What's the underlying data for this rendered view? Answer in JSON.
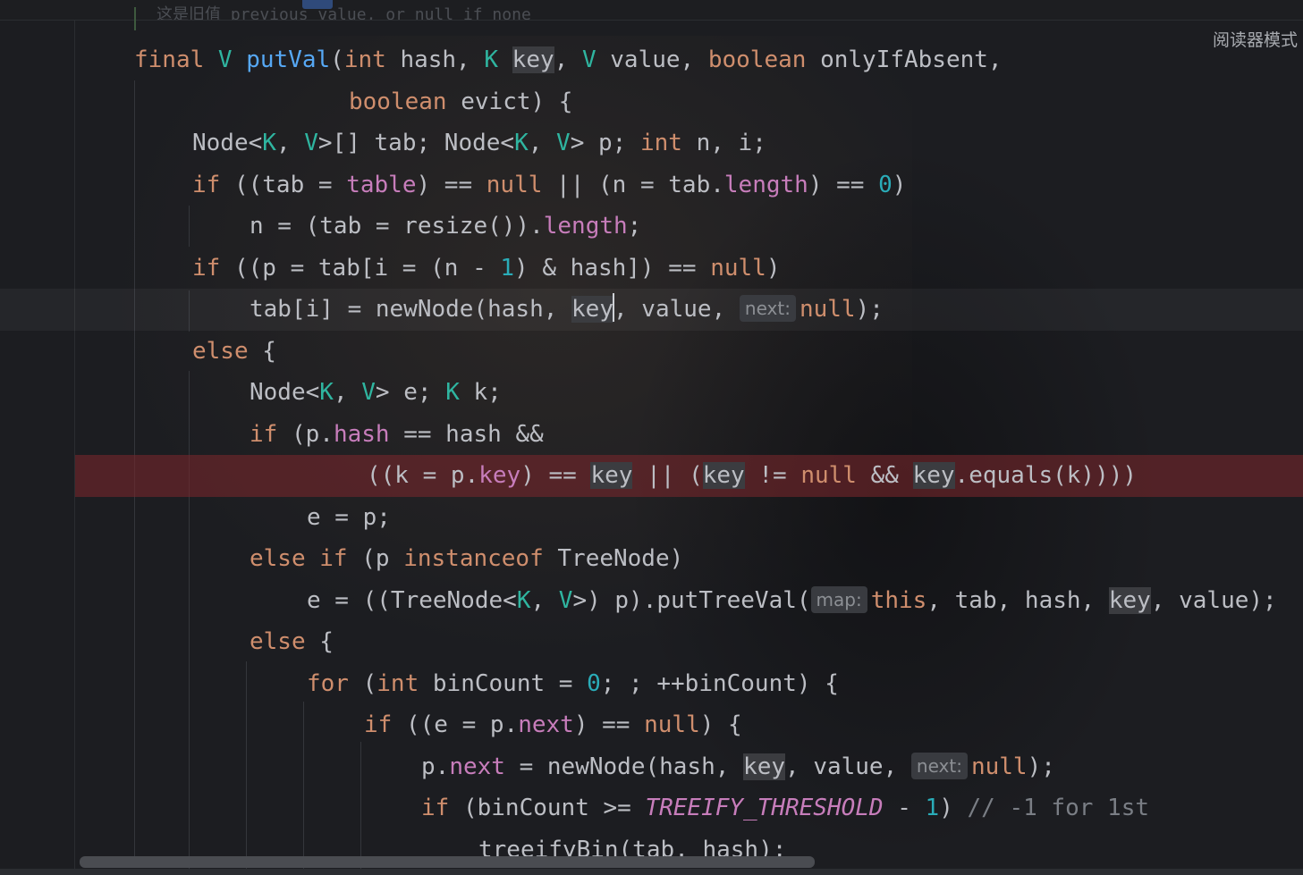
{
  "top_hint": "这是旧值 previous value, or null if none",
  "reader_mode_label": "阅读器模式",
  "code_lines": [
    {
      "indent": 150,
      "parts": [
        {
          "t": "final ",
          "c": "kw"
        },
        {
          "t": "V ",
          "c": "ty"
        },
        {
          "t": "putVal",
          "c": "fn"
        },
        {
          "t": "("
        },
        {
          "t": "int ",
          "c": "kw"
        },
        {
          "t": "hash, "
        },
        {
          "t": "K ",
          "c": "ty"
        },
        {
          "t": "key",
          "c": "hl"
        },
        {
          "t": ", "
        },
        {
          "t": "V ",
          "c": "ty"
        },
        {
          "t": "value, "
        },
        {
          "t": "boolean ",
          "c": "kw"
        },
        {
          "t": "onlyIfAbsent,"
        }
      ]
    },
    {
      "indent": 390,
      "parts": [
        {
          "t": "boolean ",
          "c": "kw"
        },
        {
          "t": "evict) {"
        }
      ]
    },
    {
      "indent": 215,
      "parts": [
        {
          "t": "Node<"
        },
        {
          "t": "K",
          "c": "ty"
        },
        {
          "t": ", "
        },
        {
          "t": "V",
          "c": "ty"
        },
        {
          "t": ">[] tab; Node<"
        },
        {
          "t": "K",
          "c": "ty"
        },
        {
          "t": ", "
        },
        {
          "t": "V",
          "c": "ty"
        },
        {
          "t": "> p; "
        },
        {
          "t": "int ",
          "c": "kw"
        },
        {
          "t": "n, i;"
        }
      ]
    },
    {
      "indent": 215,
      "parts": [
        {
          "t": "if ",
          "c": "kw"
        },
        {
          "t": "((tab = "
        },
        {
          "t": "table",
          "c": "fld"
        },
        {
          "t": ") == "
        },
        {
          "t": "null",
          "c": "kw"
        },
        {
          "t": " || (n = tab."
        },
        {
          "t": "length",
          "c": "fld"
        },
        {
          "t": ") == "
        },
        {
          "t": "0",
          "c": "num"
        },
        {
          "t": ")"
        }
      ]
    },
    {
      "indent": 279,
      "parts": [
        {
          "t": "n = (tab = resize())."
        },
        {
          "t": "length",
          "c": "fld"
        },
        {
          "t": ";"
        }
      ]
    },
    {
      "indent": 215,
      "parts": [
        {
          "t": "if ",
          "c": "kw"
        },
        {
          "t": "((p = tab[i = (n - "
        },
        {
          "t": "1",
          "c": "num"
        },
        {
          "t": ") & hash]) == "
        },
        {
          "t": "null",
          "c": "kw"
        },
        {
          "t": ")"
        }
      ]
    },
    {
      "indent": 279,
      "current": true,
      "parts": [
        {
          "t": "tab[i] = newNode(hash, "
        },
        {
          "t": "key",
          "c": "hl",
          "cursor": true
        },
        {
          "t": ", value, "
        },
        {
          "hint": "next:"
        },
        {
          "t": "null",
          "c": "kw"
        },
        {
          "t": ");"
        }
      ]
    },
    {
      "indent": 215,
      "parts": [
        {
          "t": "else ",
          "c": "kw"
        },
        {
          "t": "{"
        }
      ]
    },
    {
      "indent": 279,
      "parts": [
        {
          "t": "Node<"
        },
        {
          "t": "K",
          "c": "ty"
        },
        {
          "t": ", "
        },
        {
          "t": "V",
          "c": "ty"
        },
        {
          "t": "> e; "
        },
        {
          "t": "K ",
          "c": "ty"
        },
        {
          "t": "k;"
        }
      ]
    },
    {
      "indent": 279,
      "parts": [
        {
          "t": "if ",
          "c": "kw"
        },
        {
          "t": "(p."
        },
        {
          "t": "hash",
          "c": "fld"
        },
        {
          "t": " == hash &&"
        }
      ]
    },
    {
      "indent": 410,
      "breakpoint": true,
      "parts": [
        {
          "t": "((k = p."
        },
        {
          "t": "key",
          "c": "fld"
        },
        {
          "t": ") == "
        },
        {
          "t": "key",
          "c": "hl"
        },
        {
          "t": " || ("
        },
        {
          "t": "key",
          "c": "hl"
        },
        {
          "t": " != "
        },
        {
          "t": "null",
          "c": "kw"
        },
        {
          "t": " && "
        },
        {
          "t": "key",
          "c": "hl"
        },
        {
          "t": ".equals(k)))"
        },
        {
          "t": ")"
        }
      ]
    },
    {
      "indent": 343,
      "parts": [
        {
          "t": "e = p;"
        }
      ]
    },
    {
      "indent": 279,
      "parts": [
        {
          "t": "else if ",
          "c": "kw"
        },
        {
          "t": "(p "
        },
        {
          "t": "instanceof ",
          "c": "kw"
        },
        {
          "t": "TreeNode)"
        }
      ]
    },
    {
      "indent": 343,
      "parts": [
        {
          "t": "e = ((TreeNode<"
        },
        {
          "t": "K",
          "c": "ty"
        },
        {
          "t": ", "
        },
        {
          "t": "V",
          "c": "ty"
        },
        {
          "t": ">) p).putTreeVal("
        },
        {
          "hint": "map:"
        },
        {
          "t": "this",
          "c": "kw"
        },
        {
          "t": ", tab, hash, "
        },
        {
          "t": "key",
          "c": "hl"
        },
        {
          "t": ", value);"
        }
      ]
    },
    {
      "indent": 279,
      "parts": [
        {
          "t": "else ",
          "c": "kw"
        },
        {
          "t": "{"
        }
      ]
    },
    {
      "indent": 343,
      "parts": [
        {
          "t": "for ",
          "c": "kw"
        },
        {
          "t": "("
        },
        {
          "t": "int ",
          "c": "kw"
        },
        {
          "t": "binCount = "
        },
        {
          "t": "0",
          "c": "num"
        },
        {
          "t": "; ; ++binCount) {"
        }
      ]
    },
    {
      "indent": 407,
      "parts": [
        {
          "t": "if ",
          "c": "kw"
        },
        {
          "t": "((e = p."
        },
        {
          "t": "next",
          "c": "fld"
        },
        {
          "t": ") == "
        },
        {
          "t": "null",
          "c": "kw"
        },
        {
          "t": ") {"
        }
      ]
    },
    {
      "indent": 471,
      "parts": [
        {
          "t": "p."
        },
        {
          "t": "next",
          "c": "fld"
        },
        {
          "t": " = newNode(hash, "
        },
        {
          "t": "key",
          "c": "hl"
        },
        {
          "t": ", value, "
        },
        {
          "hint": "next:"
        },
        {
          "t": "null",
          "c": "kw"
        },
        {
          "t": ");"
        }
      ]
    },
    {
      "indent": 471,
      "parts": [
        {
          "t": "if ",
          "c": "kw"
        },
        {
          "t": "(binCount >= "
        },
        {
          "t": "TREEIFY_THRESHOLD",
          "c": "cst"
        },
        {
          "t": " - "
        },
        {
          "t": "1",
          "c": "num"
        },
        {
          "t": ") "
        },
        {
          "t": "// -1 for 1st",
          "c": "cmt"
        }
      ]
    },
    {
      "indent": 535,
      "parts": [
        {
          "t": "treeifyBin(tab, hash);"
        }
      ]
    }
  ]
}
